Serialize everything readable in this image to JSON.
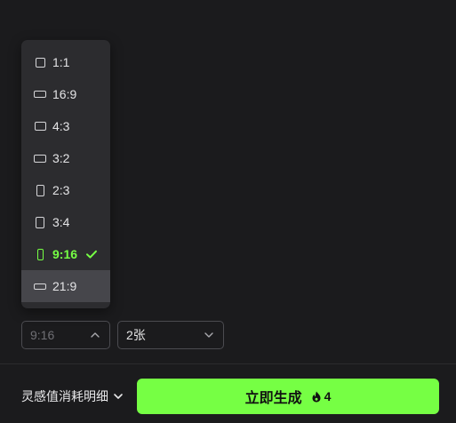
{
  "ratio_menu": {
    "options": [
      "1:1",
      "16:9",
      "4:3",
      "3:2",
      "2:3",
      "3:4",
      "9:16",
      "21:9"
    ],
    "selected": "9:16",
    "hovered": "21:9"
  },
  "ratio_select": {
    "value": "9:16"
  },
  "count_select": {
    "value": "2张"
  },
  "footer": {
    "cost_detail_label": "灵感值消耗明细",
    "generate_label": "立即生成",
    "generate_cost": "4"
  },
  "colors": {
    "accent": "#76ff44",
    "background": "#1b1b1d",
    "menu_bg": "#2c2c2f",
    "hover_bg": "#46464b"
  }
}
